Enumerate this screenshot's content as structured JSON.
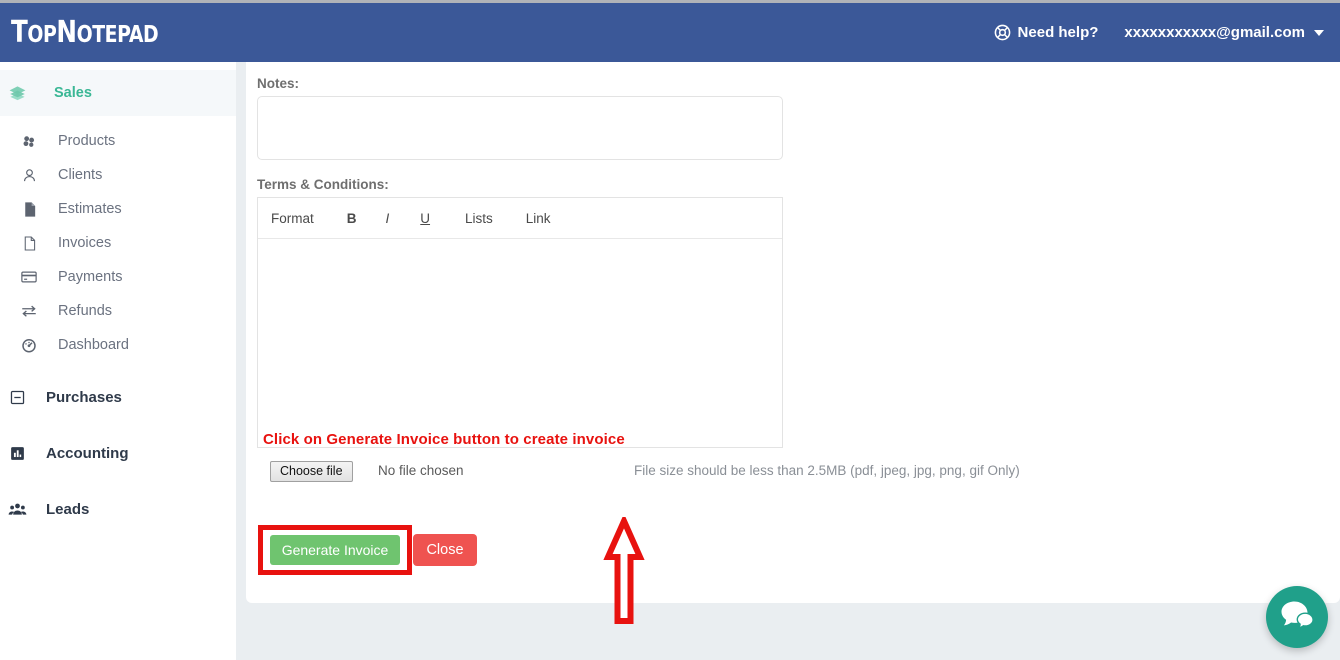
{
  "brand": {
    "part1": "T",
    "part2": "OP",
    "part3": "N",
    "part4": "OTEPAD"
  },
  "navbar": {
    "help_label": "Need help?",
    "help_icon": "lifebuoy-icon",
    "user_email": "xxxxxxxxxxx@gmail.com",
    "caret_icon": "chevron-down-icon",
    "bg_color": "#3b5898"
  },
  "sidebar": {
    "group": {
      "label": "Sales",
      "icon": "layers-icon",
      "active_color": "#3ab795"
    },
    "sub_items": [
      {
        "label": "Products",
        "icon": "cubes-icon"
      },
      {
        "label": "Clients",
        "icon": "user-icon"
      },
      {
        "label": "Estimates",
        "icon": "file-filled-icon"
      },
      {
        "label": "Invoices",
        "icon": "file-outline-icon"
      },
      {
        "label": "Payments",
        "icon": "credit-card-icon"
      },
      {
        "label": "Refunds",
        "icon": "exchange-arrows-icon"
      },
      {
        "label": "Dashboard",
        "icon": "speedometer-icon"
      }
    ],
    "main_items": [
      {
        "label": "Purchases",
        "icon": "minus-square-icon"
      },
      {
        "label": "Accounting",
        "icon": "bar-chart-icon"
      },
      {
        "label": "Leads",
        "icon": "users-group-icon"
      }
    ]
  },
  "form": {
    "notes_label": "Notes:",
    "notes_value": "",
    "notes_placeholder": "",
    "terms_label": "Terms & Conditions:",
    "terms_value": "",
    "toolbar": {
      "format": "Format",
      "bold": "B",
      "italic": "I",
      "underline": "U",
      "lists": "Lists",
      "link": "Link"
    },
    "file": {
      "choose_label": "Choose file",
      "status": "No file chosen",
      "note": "File size should be less than 2.5MB (pdf, jpeg, jpg, png, gif Only)"
    },
    "buttons": {
      "generate": "Generate Invoice",
      "close": "Close",
      "generate_color": "#6fc46f",
      "close_color": "#ef5350"
    }
  },
  "annotation": {
    "text": "Click on Generate Invoice button to create invoice",
    "color": "#e8120f",
    "arrow_icon": "up-arrow-annotation-icon"
  },
  "chat": {
    "icon": "chat-bubbles-icon",
    "color": "#20a08a"
  }
}
